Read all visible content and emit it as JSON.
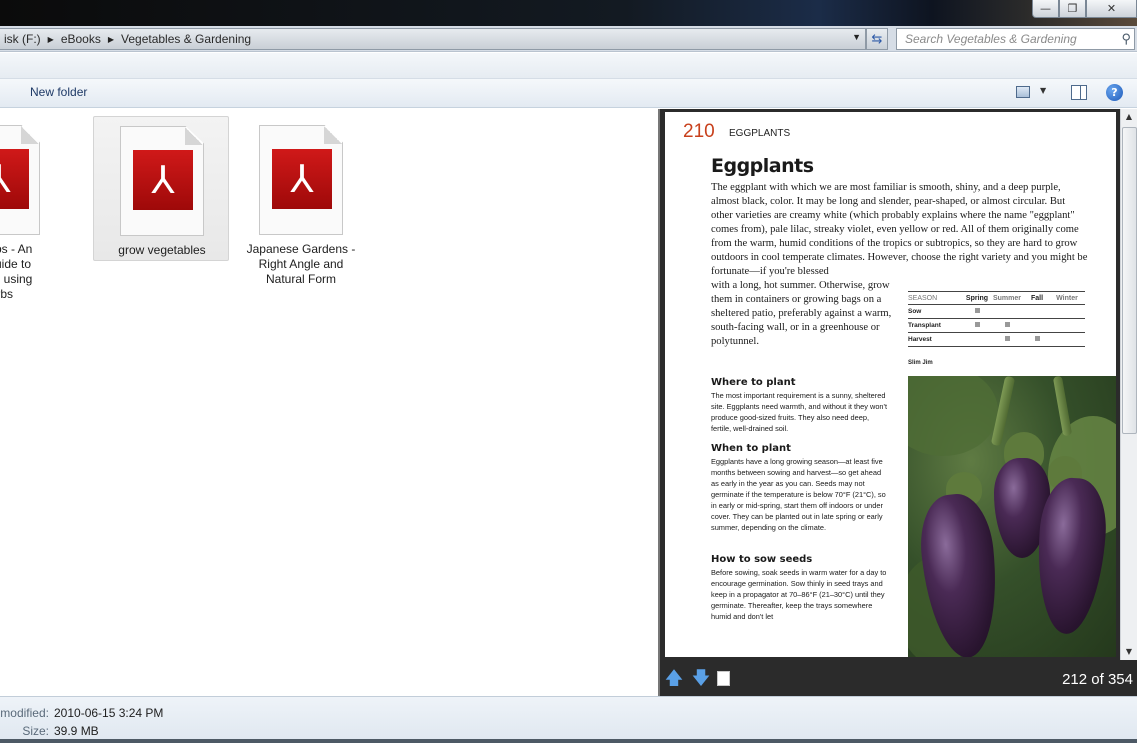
{
  "window": {
    "minimize_label": "—",
    "maximize_label": "❐",
    "close_label": "✕"
  },
  "address": {
    "crumbs": [
      "isk (F:)",
      "eBooks",
      "Vegetables & Gardening"
    ],
    "search_placeholder": "Search Vegetables & Gardening"
  },
  "toolbar": {
    "new_folder_label": "New folder",
    "help_label": "?"
  },
  "files": [
    {
      "label": "w Herbs - An\nring guide to\nng and using\nherbs",
      "selected": false
    },
    {
      "label": "grow vegetables",
      "selected": true
    },
    {
      "label": "Japanese Gardens -\nRight Angle and\nNatural Form",
      "selected": false
    }
  ],
  "preview": {
    "page_number": "210",
    "page_header": "EGGPLANTS",
    "title": "Eggplants",
    "intro": "The eggplant with which we are most familiar is smooth, shiny, and a deep purple, almost black, color. It may be long and slender, pear-shaped, or almost circular. But other varieties are creamy white (which probably explains where the name \"eggplant\" comes from), pale lilac, streaky violet, even yellow or red. All of them originally come from the warm, humid conditions of the tropics or subtropics, so they are hard to grow outdoors in cool temperate climates. However, choose the right variety and you might be fortunate—if you're blessed",
    "intro_cont": "with a long, hot summer. Otherwise, grow them in containers or growing bags on a sheltered patio, preferably against a warm, south-facing wall, or in a greenhouse or polytunnel.",
    "season_table": {
      "headers": [
        "SEASON",
        "Spring",
        "Summer",
        "Fall",
        "Winter"
      ],
      "rows": [
        {
          "label": "Sow",
          "marks": [
            true,
            false,
            false,
            false
          ]
        },
        {
          "label": "Transplant",
          "marks": [
            true,
            true,
            false,
            false
          ]
        },
        {
          "label": "Harvest",
          "marks": [
            false,
            true,
            true,
            false
          ]
        }
      ]
    },
    "photo_credit": "Slim Jim",
    "sections": [
      {
        "heading": "Where to plant",
        "text": "The most important requirement is a sunny, sheltered site. Eggplants need warmth, and without it they won't produce good-sized fruits. They also need deep, fertile, well-drained soil."
      },
      {
        "heading": "When to plant",
        "text": "Eggplants have a long growing season—at least five months between sowing and harvest—so get ahead as early in the year as you can. Seeds may not germinate if the temperature is below 70°F (21°C), so in early or mid-spring, start them off indoors or under cover. They can be planted out in late spring or early summer, depending on the climate."
      },
      {
        "heading": "How to sow seeds",
        "text": "Before sowing, soak seeds in warm water for a day to encourage germination. Sow thinly in seed trays and keep in a propagator at 70–86°F (21–30°C) until they germinate. Thereafter, keep the trays somewhere humid and don't let"
      }
    ],
    "page_count": "212 of 354",
    "nav_up_icon": "arrow-up-icon",
    "nav_down_icon": "arrow-down-icon"
  },
  "details": {
    "modified_label": "modified:",
    "modified_value": "2010-06-15 3:24 PM",
    "size_label": "Size:",
    "size_value": "39.9 MB"
  },
  "colors": {
    "accent_red": "#c8401c",
    "pdf_red": "#b71010",
    "nav_blue": "#5aa0e6"
  }
}
